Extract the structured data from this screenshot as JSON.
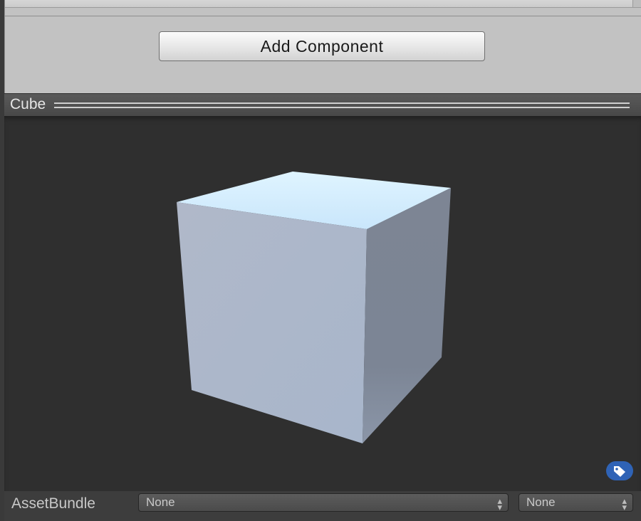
{
  "inspector": {
    "add_component_label": "Add Component"
  },
  "preview": {
    "title": "Cube",
    "object": "cube-mesh"
  },
  "asset_bundle": {
    "label": "AssetBundle",
    "name_value": "None",
    "variant_value": "None"
  },
  "icons": {
    "label_icon": "tag-icon",
    "dropdown_arrows": "up-down-arrows-icon"
  },
  "colors": {
    "preview_bg": "#2f2f2f",
    "label_icon_bg": "#2f63b6"
  }
}
